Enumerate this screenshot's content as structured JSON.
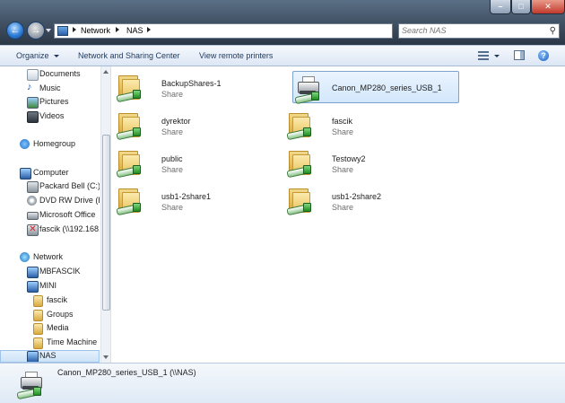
{
  "address": {
    "crumbs": [
      "Network",
      "NAS"
    ],
    "search_placeholder": "Search NAS"
  },
  "toolbar": {
    "organize": "Organize",
    "network_sharing": "Network and Sharing Center",
    "view_printers": "View remote printers"
  },
  "nav": {
    "items": [
      {
        "label": "Documents",
        "icon": "documents-icon"
      },
      {
        "label": "Music",
        "icon": "music-icon"
      },
      {
        "label": "Pictures",
        "icon": "pictures-icon"
      },
      {
        "label": "Videos",
        "icon": "videos-icon"
      },
      {
        "label": "Homegroup",
        "icon": "homegroup-icon"
      },
      {
        "label": "Computer",
        "icon": "computer-icon"
      },
      {
        "label": "Packard Bell (C:)",
        "icon": "drive-icon"
      },
      {
        "label": "DVD RW Drive (D",
        "icon": "dvd-icon"
      },
      {
        "label": "Microsoft Office",
        "icon": "drive-icon"
      },
      {
        "label": "fascik (\\\\192.168.",
        "icon": "network-drive-icon"
      },
      {
        "label": "Network",
        "icon": "network-icon"
      },
      {
        "label": "MBFASCIK",
        "icon": "computer-icon"
      },
      {
        "label": "MINI",
        "icon": "computer-icon"
      },
      {
        "label": "fascik",
        "icon": "folder-icon"
      },
      {
        "label": "Groups",
        "icon": "folder-icon"
      },
      {
        "label": "Media",
        "icon": "folder-icon"
      },
      {
        "label": "Time Machine",
        "icon": "folder-icon"
      },
      {
        "label": "NAS",
        "icon": "computer-icon"
      }
    ]
  },
  "shares": [
    {
      "name": "BackupShares-1",
      "type": "Share",
      "kind": "folder"
    },
    {
      "name": "Canon_MP280_series_USB_1",
      "type": "",
      "kind": "printer"
    },
    {
      "name": "dyrektor",
      "type": "Share",
      "kind": "folder"
    },
    {
      "name": "fascik",
      "type": "Share",
      "kind": "folder"
    },
    {
      "name": "public",
      "type": "Share",
      "kind": "folder"
    },
    {
      "name": "Testowy2",
      "type": "Share",
      "kind": "folder"
    },
    {
      "name": "usb1-2share1",
      "type": "Share",
      "kind": "folder"
    },
    {
      "name": "usb1-2share2",
      "type": "Share",
      "kind": "folder"
    }
  ],
  "details": {
    "name": "Canon_MP280_series_USB_1 (\\\\NAS)"
  },
  "colors": {
    "accent": "#2d7cd6",
    "selection": "#d3e7fb",
    "toolbar_text": "#1e395b"
  }
}
